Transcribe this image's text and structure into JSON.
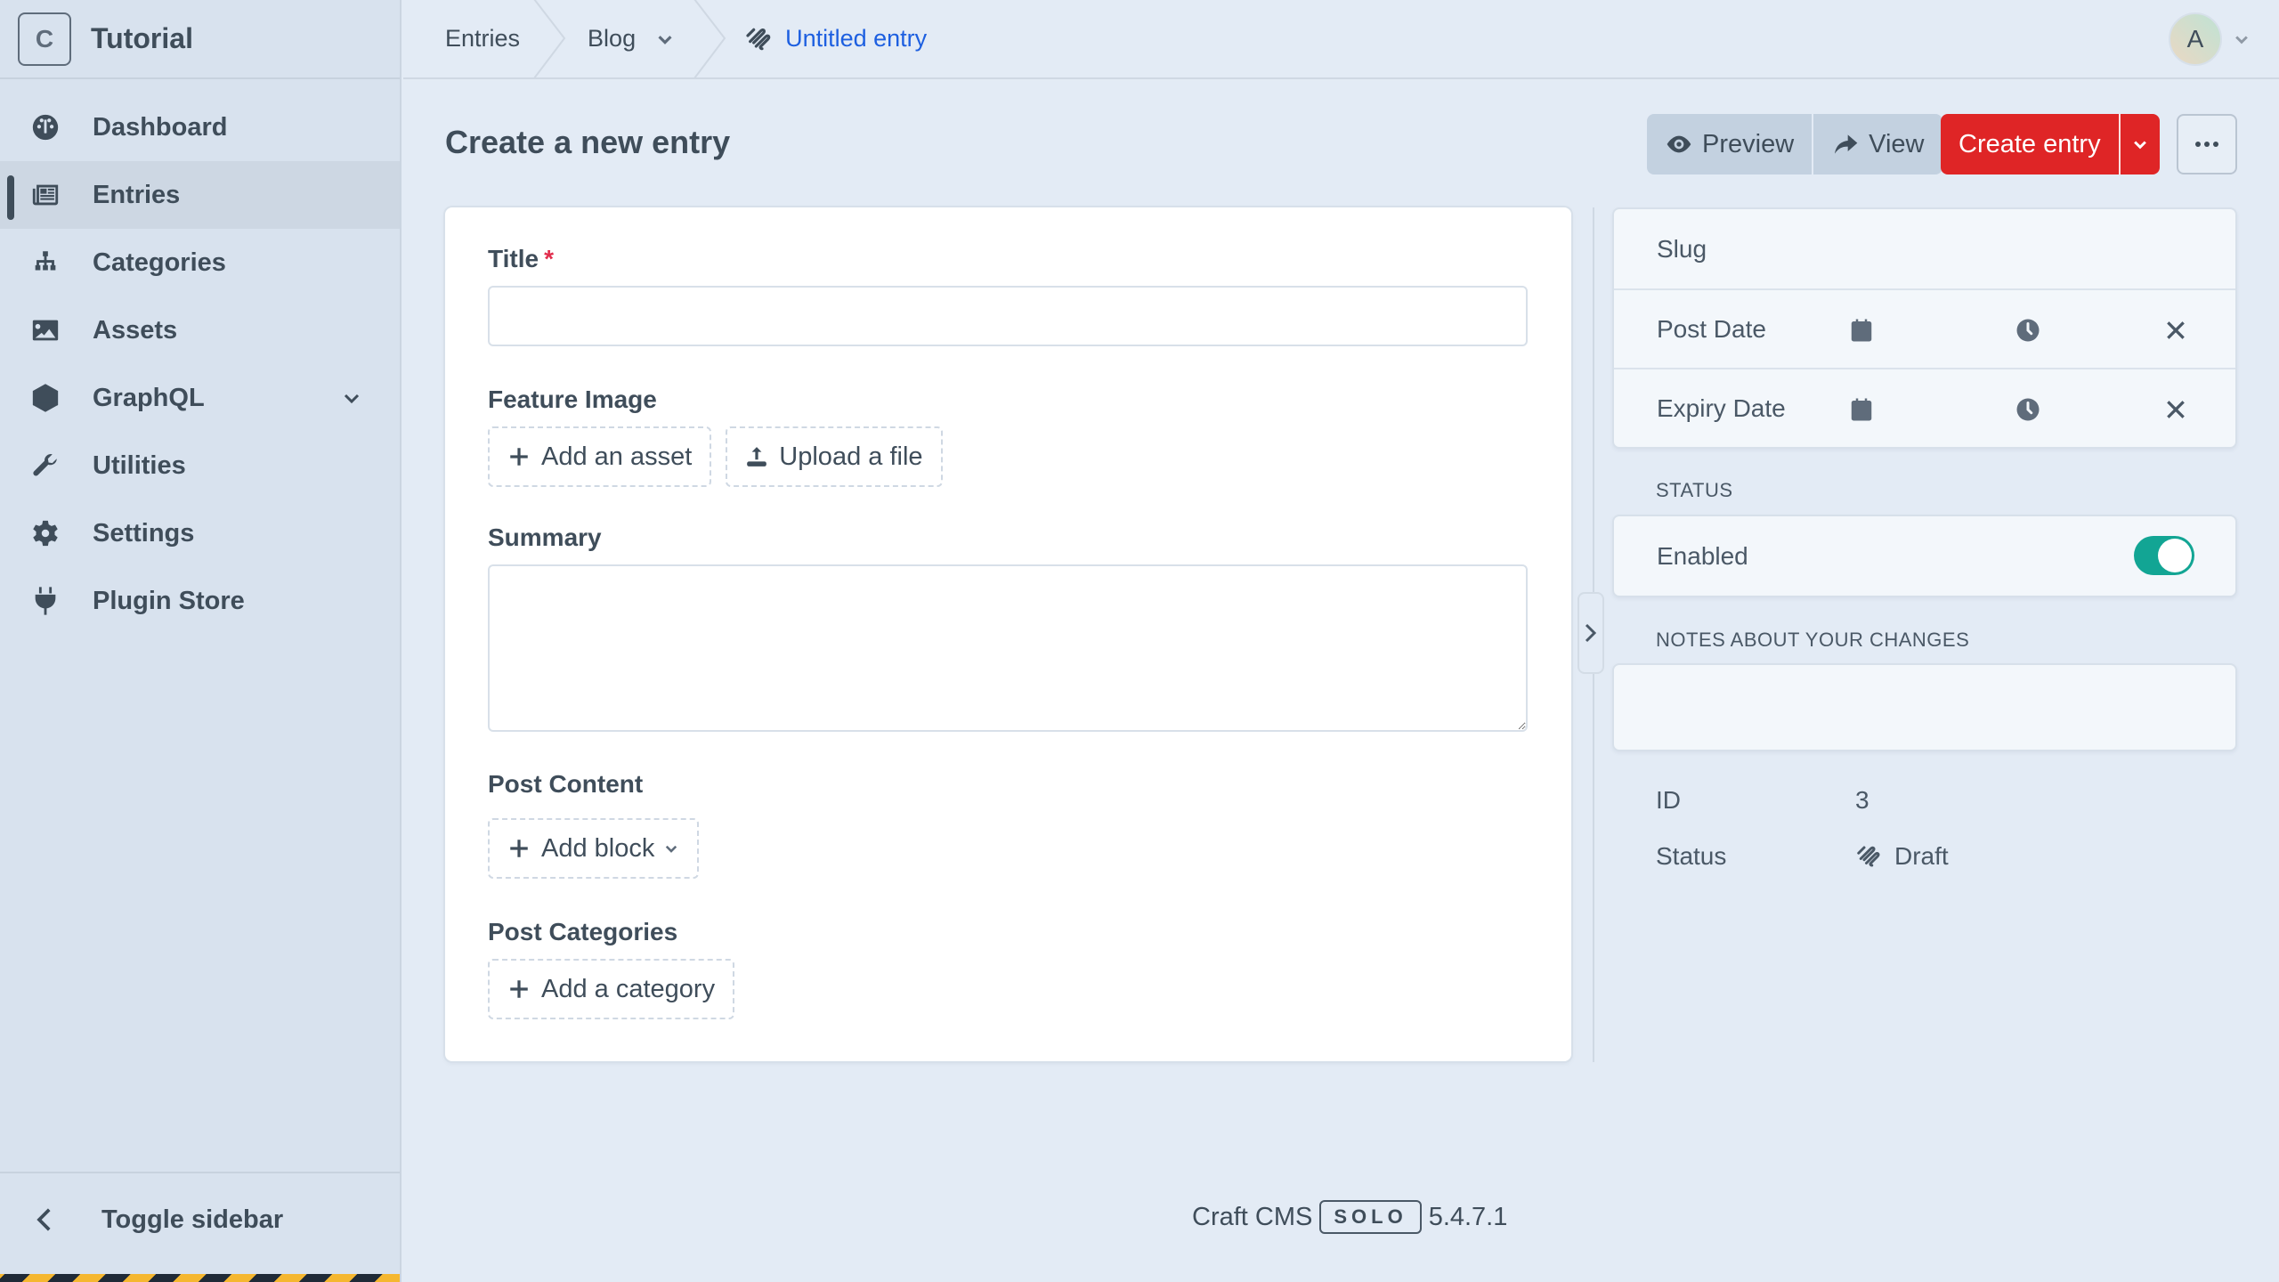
{
  "brand": {
    "logo_letter": "C",
    "site_name": "Tutorial"
  },
  "sidebar": {
    "items": [
      {
        "label": "Dashboard",
        "icon": "gauge-icon",
        "active": false
      },
      {
        "label": "Entries",
        "icon": "newspaper-icon",
        "active": true
      },
      {
        "label": "Categories",
        "icon": "sitemap-icon",
        "active": false
      },
      {
        "label": "Assets",
        "icon": "image-icon",
        "active": false
      },
      {
        "label": "GraphQL",
        "icon": "graphql-icon",
        "active": false,
        "has_submenu": true
      },
      {
        "label": "Utilities",
        "icon": "wrench-icon",
        "active": false
      },
      {
        "label": "Settings",
        "icon": "gear-icon",
        "active": false
      },
      {
        "label": "Plugin Store",
        "icon": "plug-icon",
        "active": false
      }
    ],
    "toggle_label": "Toggle sidebar"
  },
  "breadcrumb": {
    "items": [
      {
        "label": "Entries"
      },
      {
        "label": "Blog",
        "has_menu": true
      },
      {
        "label": "Untitled entry",
        "icon": "draft-icon",
        "current": true
      }
    ]
  },
  "user": {
    "avatar_initial": "A"
  },
  "page": {
    "title": "Create a new entry"
  },
  "actions": {
    "preview_label": "Preview",
    "view_label": "View",
    "create_label": "Create entry",
    "more_label": "..."
  },
  "form": {
    "title": {
      "label": "Title",
      "required_mark": "*",
      "value": "",
      "placeholder": ""
    },
    "feature_image": {
      "label": "Feature Image",
      "add_label": "Add an asset",
      "upload_label": "Upload a file"
    },
    "summary": {
      "label": "Summary",
      "value": ""
    },
    "post_content": {
      "label": "Post Content",
      "add_block_label": "Add block"
    },
    "post_categories": {
      "label": "Post Categories",
      "add_label": "Add a category"
    }
  },
  "meta": {
    "slug_label": "Slug",
    "post_date_label": "Post Date",
    "expiry_date_label": "Expiry Date",
    "status_heading": "STATUS",
    "enabled_label": "Enabled",
    "enabled": true,
    "notes_heading": "NOTES ABOUT YOUR CHANGES",
    "notes_value": "",
    "id_label": "ID",
    "id_value": "3",
    "status_label": "Status",
    "status_value": "Draft"
  },
  "footer": {
    "product": "Craft CMS",
    "edition": "SOLO",
    "version": "5.4.7.1"
  },
  "colors": {
    "primary": "#df2526",
    "link": "#1d5fe0",
    "toggle_on": "#12a594",
    "required": "#e12d4c"
  }
}
